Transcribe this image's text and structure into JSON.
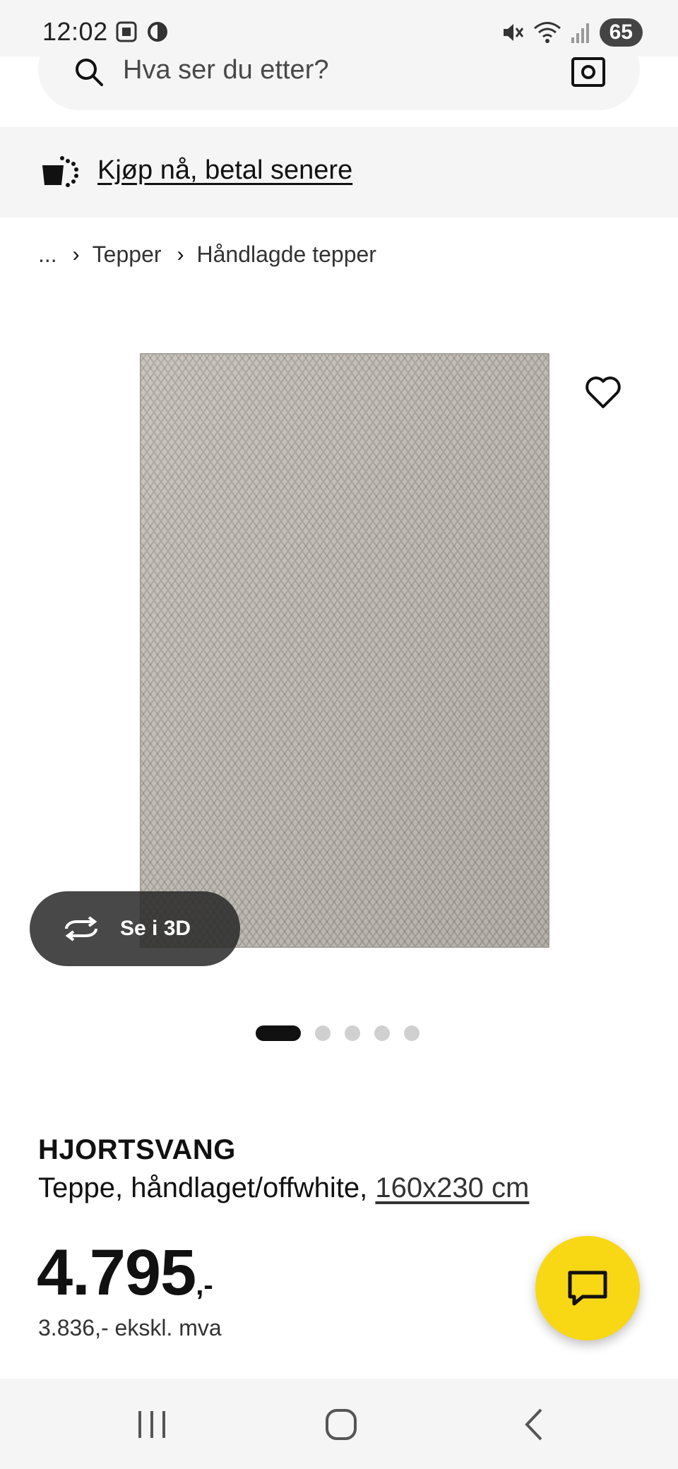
{
  "status_bar": {
    "time": "12:02",
    "battery": "65",
    "icons": [
      "screenshot-icon",
      "data-saver-icon",
      "mute-icon",
      "wifi-icon",
      "signal-icon"
    ]
  },
  "search": {
    "placeholder": "Hva ser du etter?"
  },
  "banner": {
    "label": "Kjøp nå, betal senere"
  },
  "breadcrumb": {
    "ellipsis": "...",
    "items": [
      "Tepper",
      "Håndlagde tepper"
    ]
  },
  "media": {
    "view_3d_label": "Se i 3D",
    "dots_total": 5,
    "dots_active": 1
  },
  "product": {
    "name": "HJORTSVANG",
    "description": "Teppe, håndlaget/offwhite, ",
    "size": "160x230 cm",
    "price_main": "4.795",
    "price_suffix": ",-",
    "price_ex_vat": "3.836,- ekskl. mva"
  },
  "colors": {
    "accent_yellow": "#f8d715",
    "rug_gray": "#bdb8b0",
    "surface": "#f5f5f5"
  }
}
